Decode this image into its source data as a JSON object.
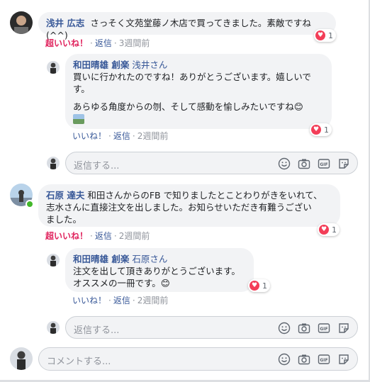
{
  "comments": [
    {
      "author": "浅井 広志",
      "text": "さっそく文苑堂藤ノ木店で買ってきました。素敵ですね(^^)",
      "reactions": "1",
      "actions": {
        "like": "超いいね！",
        "reply": "返信",
        "time": "3週間前"
      },
      "reply": {
        "author": "和田晴雄 創楽",
        "mention": "浅井さん",
        "text1": "買いに行かれたのですね！ありがとうございます。嬉しいで",
        "text2": "す。",
        "text3": "あらゆる角度からの刎、そして感動を愉しみたいですね😊",
        "reactions": "1",
        "actions": {
          "like": "いいね！",
          "reply": "返信",
          "time": "2週間前"
        }
      },
      "reply_input": "返信する..."
    },
    {
      "author": "石原 達夫",
      "text1": "和田さんからのFB で知りましたとことわりがきをいれて、",
      "text2": "志水さんに直接注文を出しました。お知らせいただき有難うござい",
      "text3": "ました。",
      "reactions": "1",
      "actions": {
        "like": "超いいね！",
        "reply": "返信",
        "time": "2週間前"
      },
      "reply": {
        "author": "和田晴雄 創楽",
        "mention": "石原さん",
        "text1": "注文を出して頂きありがとうございます。",
        "text2": "オススメの一冊です。😊",
        "reactions": "1",
        "actions": {
          "like": "いいね！",
          "reply": "返信",
          "time": "2週間前"
        }
      },
      "reply_input": "返信する..."
    }
  ],
  "comment_input": "コメントする...",
  "input_icons": [
    "smiley-icon",
    "camera-icon",
    "gif-icon",
    "sticker-icon"
  ],
  "colors": {
    "link": "#385898",
    "love": "#e0245e",
    "bubble": "#f2f3f5"
  }
}
